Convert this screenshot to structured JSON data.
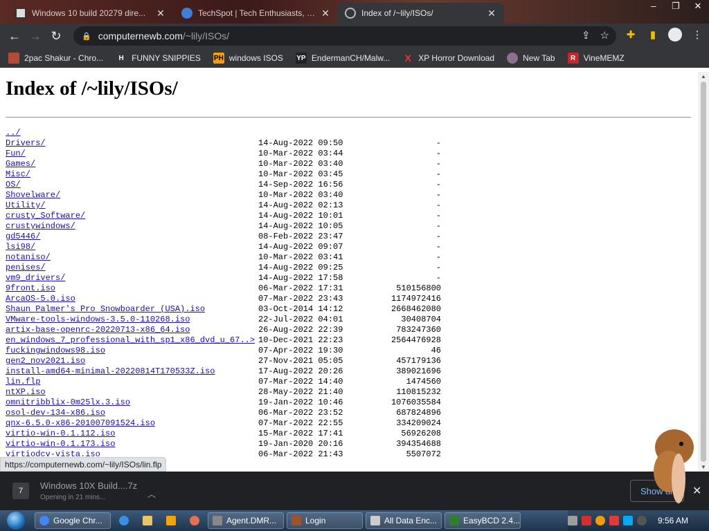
{
  "browser": {
    "tabs": [
      {
        "title": "Windows 10 build 20279 dire...",
        "active": false
      },
      {
        "title": "TechSpot | Tech Enthusiasts, Po...",
        "active": false
      },
      {
        "title": "Index of /~lily/ISOs/",
        "active": true
      }
    ],
    "window_controls": {
      "minimize": "–",
      "maximize": "❐",
      "close": "✕"
    },
    "url": {
      "host": "computernewb.com",
      "path": "/~lily/ISOs/"
    },
    "bookmarks": [
      {
        "label": "2pac Shakur - Chro...",
        "icon": "tupac-icon",
        "color": "#c0392b"
      },
      {
        "label": "FUNNY SNIPPIES",
        "icon": "h-icon",
        "color": "#ffffff"
      },
      {
        "label": "windows ISOS",
        "icon": "ph-icon",
        "color": "#f39c12"
      },
      {
        "label": "EndermanCH/Malw...",
        "icon": "yp-icon",
        "color": "#333333"
      },
      {
        "label": "XP Horror Download",
        "icon": "x-icon",
        "color": "#e53935"
      },
      {
        "label": "New Tab",
        "icon": "globe-icon",
        "color": "#8e6f8e"
      },
      {
        "label": "VineMEMZ",
        "icon": "r-icon",
        "color": "#c62828"
      }
    ]
  },
  "page": {
    "title": "Index of /~lily/ISOs/",
    "entries": [
      {
        "name": "../",
        "date": "",
        "size": ""
      },
      {
        "name": "Drivers/",
        "date": "14-Aug-2022 09:50",
        "size": "-"
      },
      {
        "name": "Fun/",
        "date": "10-Mar-2022 03:44",
        "size": "-"
      },
      {
        "name": "Games/",
        "date": "10-Mar-2022 03:40",
        "size": "-"
      },
      {
        "name": "Misc/",
        "date": "10-Mar-2022 03:45",
        "size": "-"
      },
      {
        "name": "OS/",
        "date": "14-Sep-2022 16:56",
        "size": "-"
      },
      {
        "name": "Shovelware/",
        "date": "10-Mar-2022 03:40",
        "size": "-"
      },
      {
        "name": "Utility/",
        "date": "14-Aug-2022 02:13",
        "size": "-"
      },
      {
        "name": "crusty_Software/",
        "date": "14-Aug-2022 10:01",
        "size": "-"
      },
      {
        "name": "crustywindows/",
        "date": "14-Aug-2022 10:05",
        "size": "-"
      },
      {
        "name": "gd5446/",
        "date": "08-Feb-2022 23:47",
        "size": "-"
      },
      {
        "name": "lsi98/",
        "date": "14-Aug-2022 09:07",
        "size": "-"
      },
      {
        "name": "notaniso/",
        "date": "10-Mar-2022 03:41",
        "size": "-"
      },
      {
        "name": "penises/",
        "date": "14-Aug-2022 09:25",
        "size": "-"
      },
      {
        "name": "vm9_drivers/",
        "date": "14-Aug-2022 17:58",
        "size": "-"
      },
      {
        "name": "9front.iso",
        "date": "06-Mar-2022 17:31",
        "size": "510156800"
      },
      {
        "name": "ArcaOS-5.0.iso",
        "date": "07-Mar-2022 23:43",
        "size": "1174972416"
      },
      {
        "name": "Shaun Palmer's Pro Snowboarder (USA).iso",
        "date": "03-Oct-2014 14:12",
        "size": "2668462080"
      },
      {
        "name": "VMware-tools-windows-3.5.0-110268.iso",
        "date": "22-Jul-2022 04:01",
        "size": "30408704"
      },
      {
        "name": "artix-base-openrc-20220713-x86_64.iso",
        "date": "26-Aug-2022 22:39",
        "size": "783247360"
      },
      {
        "name": "en_windows_7_professional_with_sp1_x86_dvd_u_67..>",
        "date": "10-Dec-2021 22:23",
        "size": "2564476928"
      },
      {
        "name": "fuckingwindows98.iso",
        "date": "07-Apr-2022 19:30",
        "size": "46"
      },
      {
        "name": "gen2_nov2021.iso",
        "date": "27-Nov-2021 05:05",
        "size": "457179136"
      },
      {
        "name": "install-amd64-minimal-20220814T170533Z.iso",
        "date": "17-Aug-2022 20:26",
        "size": "389021696"
      },
      {
        "name": "lin.flp",
        "date": "07-Mar-2022 14:40",
        "size": "1474560"
      },
      {
        "name": "ntXP.iso",
        "date": "28-May-2022 21:40",
        "size": "110815232"
      },
      {
        "name": "omnitribblix-0m25lx.3.iso",
        "date": "19-Jan-2022 10:46",
        "size": "1076035584"
      },
      {
        "name": "osol-dev-134-x86.iso",
        "date": "06-Mar-2022 23:52",
        "size": "687824896"
      },
      {
        "name": "qnx-6.5.0-x86-201007091524.iso",
        "date": "07-Mar-2022 22:55",
        "size": "334209024"
      },
      {
        "name": "virtio-win-0.1.112.iso",
        "date": "15-Mar-2022 17:41",
        "size": "56926208"
      },
      {
        "name": "virtio-win-0.1.173.iso",
        "date": "19-Jan-2020 20:16",
        "size": "394354688"
      },
      {
        "name": "virtiodcv-vista.iso",
        "date": "06-Mar-2022 21:43",
        "size": "5507072"
      }
    ]
  },
  "status_url": "https://computernewb.com/~lily/ISOs/lin.flp",
  "download": {
    "name": "Windows 10X Build....7z",
    "status": "Opening in 21 mins...",
    "show_all": "Show all"
  },
  "taskbar": {
    "items": [
      {
        "label": "Google Chr...",
        "color": "#4285f4"
      },
      {
        "label": "Agent.DMR...",
        "color": "#888888"
      },
      {
        "label": "Login",
        "color": "#a0522d"
      },
      {
        "label": "All Data Enc...",
        "color": "#cccccc"
      },
      {
        "label": "EasyBCD 2.4...",
        "color": "#2e7d32"
      }
    ],
    "clock": "9:56 AM"
  }
}
